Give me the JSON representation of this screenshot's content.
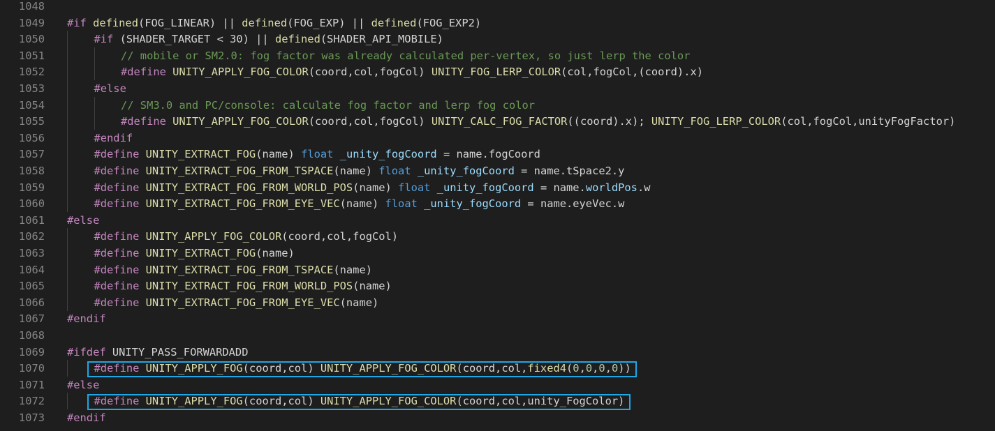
{
  "editor": {
    "language": "shader-preprocessor",
    "lines": [
      {
        "num": "1048",
        "indent": 0,
        "tokens": []
      },
      {
        "num": "1049",
        "indent": 0,
        "tokens": [
          {
            "c": "kw",
            "t": "#if"
          },
          {
            "c": "pl",
            "t": " "
          },
          {
            "c": "fn",
            "t": "defined"
          },
          {
            "c": "pl",
            "t": "(FOG_LINEAR) || "
          },
          {
            "c": "fn",
            "t": "defined"
          },
          {
            "c": "pl",
            "t": "(FOG_EXP) || "
          },
          {
            "c": "fn",
            "t": "defined"
          },
          {
            "c": "pl",
            "t": "(FOG_EXP2)"
          }
        ]
      },
      {
        "num": "1050",
        "indent": 1,
        "tokens": [
          {
            "c": "kw",
            "t": "#if"
          },
          {
            "c": "pl",
            "t": " (SHADER_TARGET < 30) || "
          },
          {
            "c": "fn",
            "t": "defined"
          },
          {
            "c": "pl",
            "t": "(SHADER_API_MOBILE)"
          }
        ]
      },
      {
        "num": "1051",
        "indent": 2,
        "tokens": [
          {
            "c": "cm",
            "t": "// mobile or SM2.0: fog factor was already calculated per-vertex, so just lerp the color"
          }
        ]
      },
      {
        "num": "1052",
        "indent": 2,
        "tokens": [
          {
            "c": "kw",
            "t": "#define"
          },
          {
            "c": "pl",
            "t": " "
          },
          {
            "c": "fn",
            "t": "UNITY_APPLY_FOG_COLOR"
          },
          {
            "c": "pl",
            "t": "(coord,col,fogCol) "
          },
          {
            "c": "fn",
            "t": "UNITY_FOG_LERP_COLOR"
          },
          {
            "c": "pl",
            "t": "(col,fogCol,(coord).x)"
          }
        ]
      },
      {
        "num": "1053",
        "indent": 1,
        "tokens": [
          {
            "c": "kw",
            "t": "#else"
          }
        ]
      },
      {
        "num": "1054",
        "indent": 2,
        "tokens": [
          {
            "c": "cm",
            "t": "// SM3.0 and PC/console: calculate fog factor and lerp fog color"
          }
        ]
      },
      {
        "num": "1055",
        "indent": 2,
        "tokens": [
          {
            "c": "kw",
            "t": "#define"
          },
          {
            "c": "pl",
            "t": " "
          },
          {
            "c": "fn",
            "t": "UNITY_APPLY_FOG_COLOR"
          },
          {
            "c": "pl",
            "t": "(coord,col,fogCol) "
          },
          {
            "c": "fn",
            "t": "UNITY_CALC_FOG_FACTOR"
          },
          {
            "c": "pl",
            "t": "((coord).x); "
          },
          {
            "c": "fn",
            "t": "UNITY_FOG_LERP_COLOR"
          },
          {
            "c": "pl",
            "t": "(col,fogCol,unityFogFactor)"
          }
        ]
      },
      {
        "num": "1056",
        "indent": 1,
        "tokens": [
          {
            "c": "kw",
            "t": "#endif"
          }
        ]
      },
      {
        "num": "1057",
        "indent": 1,
        "tokens": [
          {
            "c": "kw",
            "t": "#define"
          },
          {
            "c": "pl",
            "t": " "
          },
          {
            "c": "fn",
            "t": "UNITY_EXTRACT_FOG"
          },
          {
            "c": "pl",
            "t": "(name) "
          },
          {
            "c": "type",
            "t": "float"
          },
          {
            "c": "pl",
            "t": " "
          },
          {
            "c": "var",
            "t": "_unity_fogCoord"
          },
          {
            "c": "pl",
            "t": " = name.fogCoord"
          }
        ]
      },
      {
        "num": "1058",
        "indent": 1,
        "tokens": [
          {
            "c": "kw",
            "t": "#define"
          },
          {
            "c": "pl",
            "t": " "
          },
          {
            "c": "fn",
            "t": "UNITY_EXTRACT_FOG_FROM_TSPACE"
          },
          {
            "c": "pl",
            "t": "(name) "
          },
          {
            "c": "type",
            "t": "float"
          },
          {
            "c": "pl",
            "t": " "
          },
          {
            "c": "var",
            "t": "_unity_fogCoord"
          },
          {
            "c": "pl",
            "t": " = name.tSpace2.y"
          }
        ]
      },
      {
        "num": "1059",
        "indent": 1,
        "tokens": [
          {
            "c": "kw",
            "t": "#define"
          },
          {
            "c": "pl",
            "t": " "
          },
          {
            "c": "fn",
            "t": "UNITY_EXTRACT_FOG_FROM_WORLD_POS"
          },
          {
            "c": "pl",
            "t": "(name) "
          },
          {
            "c": "type",
            "t": "float"
          },
          {
            "c": "pl",
            "t": " "
          },
          {
            "c": "var",
            "t": "_unity_fogCoord"
          },
          {
            "c": "pl",
            "t": " = name."
          },
          {
            "c": "var",
            "t": "worldPos"
          },
          {
            "c": "pl",
            "t": ".w"
          }
        ]
      },
      {
        "num": "1060",
        "indent": 1,
        "tokens": [
          {
            "c": "kw",
            "t": "#define"
          },
          {
            "c": "pl",
            "t": " "
          },
          {
            "c": "fn",
            "t": "UNITY_EXTRACT_FOG_FROM_EYE_VEC"
          },
          {
            "c": "pl",
            "t": "(name) "
          },
          {
            "c": "type",
            "t": "float"
          },
          {
            "c": "pl",
            "t": " "
          },
          {
            "c": "var",
            "t": "_unity_fogCoord"
          },
          {
            "c": "pl",
            "t": " = name.eyeVec.w"
          }
        ]
      },
      {
        "num": "1061",
        "indent": 0,
        "tokens": [
          {
            "c": "kw",
            "t": "#else"
          }
        ]
      },
      {
        "num": "1062",
        "indent": 1,
        "tokens": [
          {
            "c": "kw",
            "t": "#define"
          },
          {
            "c": "pl",
            "t": " "
          },
          {
            "c": "fn",
            "t": "UNITY_APPLY_FOG_COLOR"
          },
          {
            "c": "pl",
            "t": "(coord,col,fogCol)"
          }
        ]
      },
      {
        "num": "1063",
        "indent": 1,
        "tokens": [
          {
            "c": "kw",
            "t": "#define"
          },
          {
            "c": "pl",
            "t": " "
          },
          {
            "c": "fn",
            "t": "UNITY_EXTRACT_FOG"
          },
          {
            "c": "pl",
            "t": "(name)"
          }
        ]
      },
      {
        "num": "1064",
        "indent": 1,
        "tokens": [
          {
            "c": "kw",
            "t": "#define"
          },
          {
            "c": "pl",
            "t": " "
          },
          {
            "c": "fn",
            "t": "UNITY_EXTRACT_FOG_FROM_TSPACE"
          },
          {
            "c": "pl",
            "t": "(name)"
          }
        ]
      },
      {
        "num": "1065",
        "indent": 1,
        "tokens": [
          {
            "c": "kw",
            "t": "#define"
          },
          {
            "c": "pl",
            "t": " "
          },
          {
            "c": "fn",
            "t": "UNITY_EXTRACT_FOG_FROM_WORLD_POS"
          },
          {
            "c": "pl",
            "t": "(name)"
          }
        ]
      },
      {
        "num": "1066",
        "indent": 1,
        "tokens": [
          {
            "c": "kw",
            "t": "#define"
          },
          {
            "c": "pl",
            "t": " "
          },
          {
            "c": "fn",
            "t": "UNITY_EXTRACT_FOG_FROM_EYE_VEC"
          },
          {
            "c": "pl",
            "t": "(name)"
          }
        ]
      },
      {
        "num": "1067",
        "indent": 0,
        "tokens": [
          {
            "c": "kw",
            "t": "#endif"
          }
        ]
      },
      {
        "num": "1068",
        "indent": 0,
        "tokens": []
      },
      {
        "num": "1069",
        "indent": 0,
        "tokens": [
          {
            "c": "kw",
            "t": "#ifdef"
          },
          {
            "c": "pl",
            "t": " UNITY_PASS_FORWARDADD"
          }
        ]
      },
      {
        "num": "1070",
        "indent": 1,
        "highlight": true,
        "tokens": [
          {
            "c": "kw",
            "t": "#define"
          },
          {
            "c": "pl",
            "t": " "
          },
          {
            "c": "fn",
            "t": "UNITY_APPLY_FOG"
          },
          {
            "c": "pl",
            "t": "(coord,col) "
          },
          {
            "c": "fn",
            "t": "UNITY_APPLY_FOG_COLOR"
          },
          {
            "c": "pl",
            "t": "(coord,col,"
          },
          {
            "c": "fn",
            "t": "fixed4"
          },
          {
            "c": "pl",
            "t": "("
          },
          {
            "c": "num",
            "t": "0"
          },
          {
            "c": "pl",
            "t": ","
          },
          {
            "c": "num",
            "t": "0"
          },
          {
            "c": "pl",
            "t": ","
          },
          {
            "c": "num",
            "t": "0"
          },
          {
            "c": "pl",
            "t": ","
          },
          {
            "c": "num",
            "t": "0"
          },
          {
            "c": "pl",
            "t": "))"
          }
        ]
      },
      {
        "num": "1071",
        "indent": 0,
        "tokens": [
          {
            "c": "kw",
            "t": "#else"
          }
        ]
      },
      {
        "num": "1072",
        "indent": 1,
        "highlight": true,
        "tokens": [
          {
            "c": "kw",
            "t": "#define"
          },
          {
            "c": "pl",
            "t": " "
          },
          {
            "c": "fn",
            "t": "UNITY_APPLY_FOG"
          },
          {
            "c": "pl",
            "t": "(coord,col) "
          },
          {
            "c": "fn",
            "t": "UNITY_APPLY_FOG_COLOR"
          },
          {
            "c": "pl",
            "t": "(coord,col,unity_FogColor)"
          }
        ]
      },
      {
        "num": "1073",
        "indent": 0,
        "tokens": [
          {
            "c": "kw",
            "t": "#endif"
          }
        ]
      }
    ]
  },
  "colors": {
    "background": "#1e1e1e",
    "line_number": "#858585",
    "keyword": "#c586c0",
    "function": "#dcdcaa",
    "comment": "#6a9955",
    "type": "#569cd6",
    "variable": "#9cdcfe",
    "number": "#b5cea8",
    "plain": "#d4d4d4",
    "highlight_box": "#1ea7e6"
  }
}
